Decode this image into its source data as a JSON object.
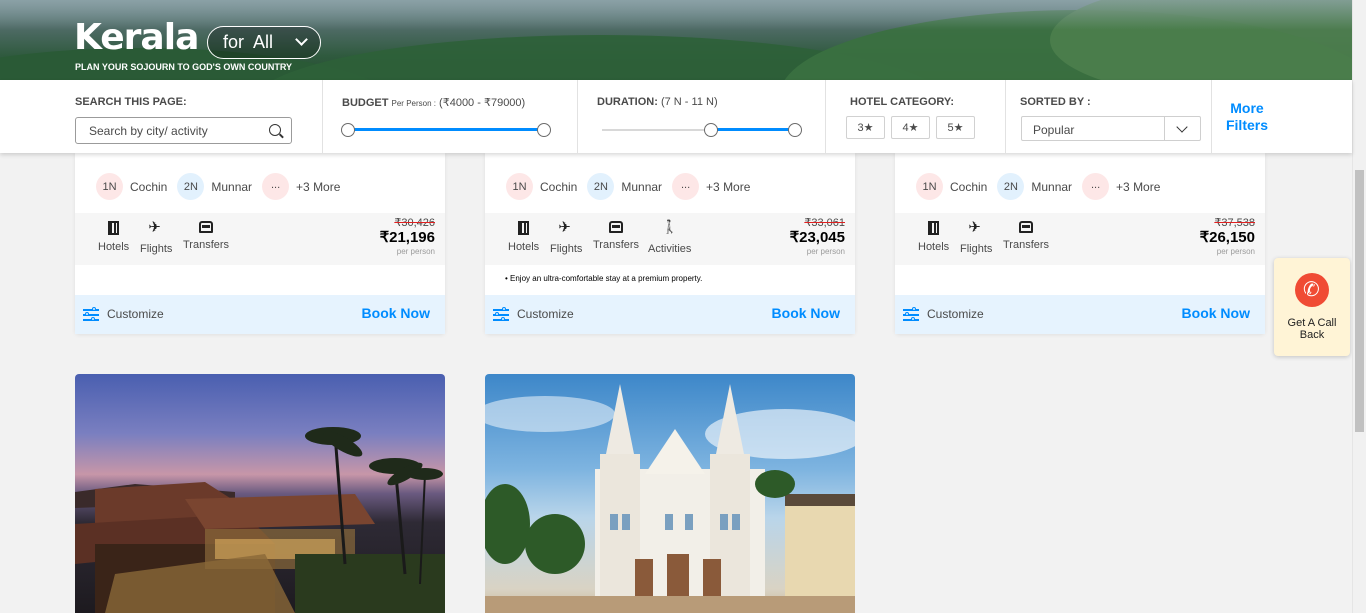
{
  "hero": {
    "title": "Kerala",
    "tagline": "PLAN YOUR SOJOURN TO GOD'S OWN COUNTRY",
    "for_dropdown": "for  All"
  },
  "filters": {
    "search_label": "SEARCH THIS PAGE:",
    "search_placeholder": "Search by city/ activity",
    "budget_label": "BUDGET",
    "budget_sub": "Per Person :",
    "budget_range": "(₹4000 - ₹79000)",
    "budget_level": [
      0.0,
      1.0
    ],
    "duration_label": "DURATION:",
    "duration_range": "(7 N - 11 N)",
    "duration_level": [
      0.55,
      1.0
    ],
    "hotel_category_label": "HOTEL CATEGORY:",
    "stars": [
      "3★",
      "4★",
      "5★"
    ],
    "sorted_label": "SORTED BY :",
    "sorted_value": "Popular",
    "more_filters": "More Filters"
  },
  "cards": [
    {
      "nights": [
        {
          "n": "1N",
          "city": "Cochin"
        },
        {
          "n": "2N",
          "city": "Munnar"
        }
      ],
      "more_dots": "...",
      "plus_more": "+3 More",
      "inclusions": [
        "Hotels",
        "Flights",
        "Transfers"
      ],
      "old_price": "₹30,426",
      "price": "₹21,196",
      "per_person": "per person",
      "note": "",
      "customize": "Customize",
      "book": "Book Now"
    },
    {
      "nights": [
        {
          "n": "1N",
          "city": "Cochin"
        },
        {
          "n": "2N",
          "city": "Munnar"
        }
      ],
      "more_dots": "...",
      "plus_more": "+3 More",
      "inclusions": [
        "Hotels",
        "Flights",
        "Transfers",
        "Activities"
      ],
      "old_price": "₹33,061",
      "price": "₹23,045",
      "per_person": "per person",
      "note": "• Enjoy an ultra-comfortable stay at a premium property.",
      "customize": "Customize",
      "book": "Book Now"
    },
    {
      "nights": [
        {
          "n": "1N",
          "city": "Cochin"
        },
        {
          "n": "2N",
          "city": "Munnar"
        }
      ],
      "more_dots": "...",
      "plus_more": "+3 More",
      "inclusions": [
        "Hotels",
        "Flights",
        "Transfers"
      ],
      "old_price": "₹37,538",
      "price": "₹26,150",
      "per_person": "per person",
      "note": "",
      "customize": "Customize",
      "book": "Book Now"
    }
  ],
  "callback": {
    "label": "Get A Call Back"
  },
  "colors": {
    "accent": "#008cff",
    "call_button": "#f04b34",
    "callback_bg": "#fff4d6"
  }
}
